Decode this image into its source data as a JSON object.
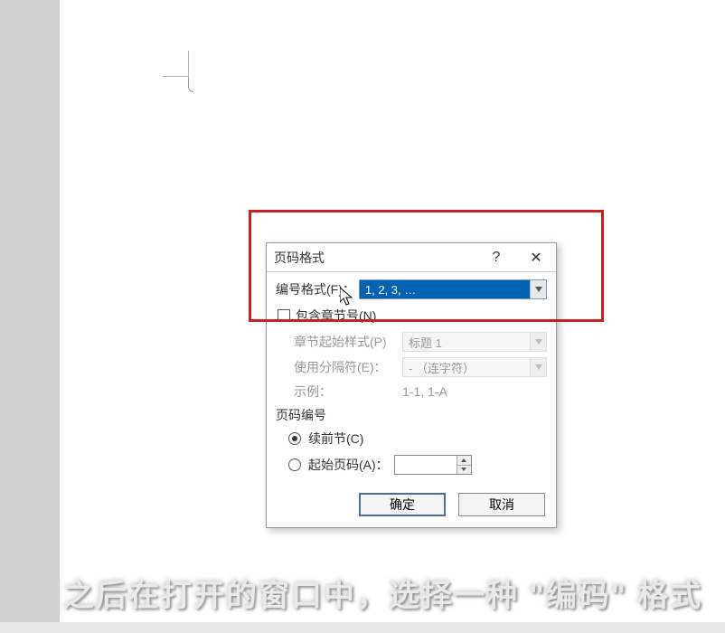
{
  "dialog": {
    "title": "页码格式",
    "help_symbol": "?",
    "close_symbol": "✕",
    "number_format_label": "编号格式(F)：",
    "number_format_value": "1, 2, 3, …",
    "include_chapter_label": "包含章节号(N)",
    "chapter_start_label": "章节起始样式(P)",
    "chapter_start_value": "标题 1",
    "separator_label": "使用分隔符(E)：",
    "separator_value": "-  （连字符）",
    "example_label": "示例：",
    "example_value": "1-1, 1-A",
    "page_numbering_label": "页码编号",
    "continue_label": "续前节(C)",
    "start_at_label": "起始页码(A)：",
    "start_at_value": "",
    "ok_label": "确定",
    "cancel_label": "取消"
  },
  "caption": "之后在打开的窗口中，选择一种 \"编码\" 格式"
}
